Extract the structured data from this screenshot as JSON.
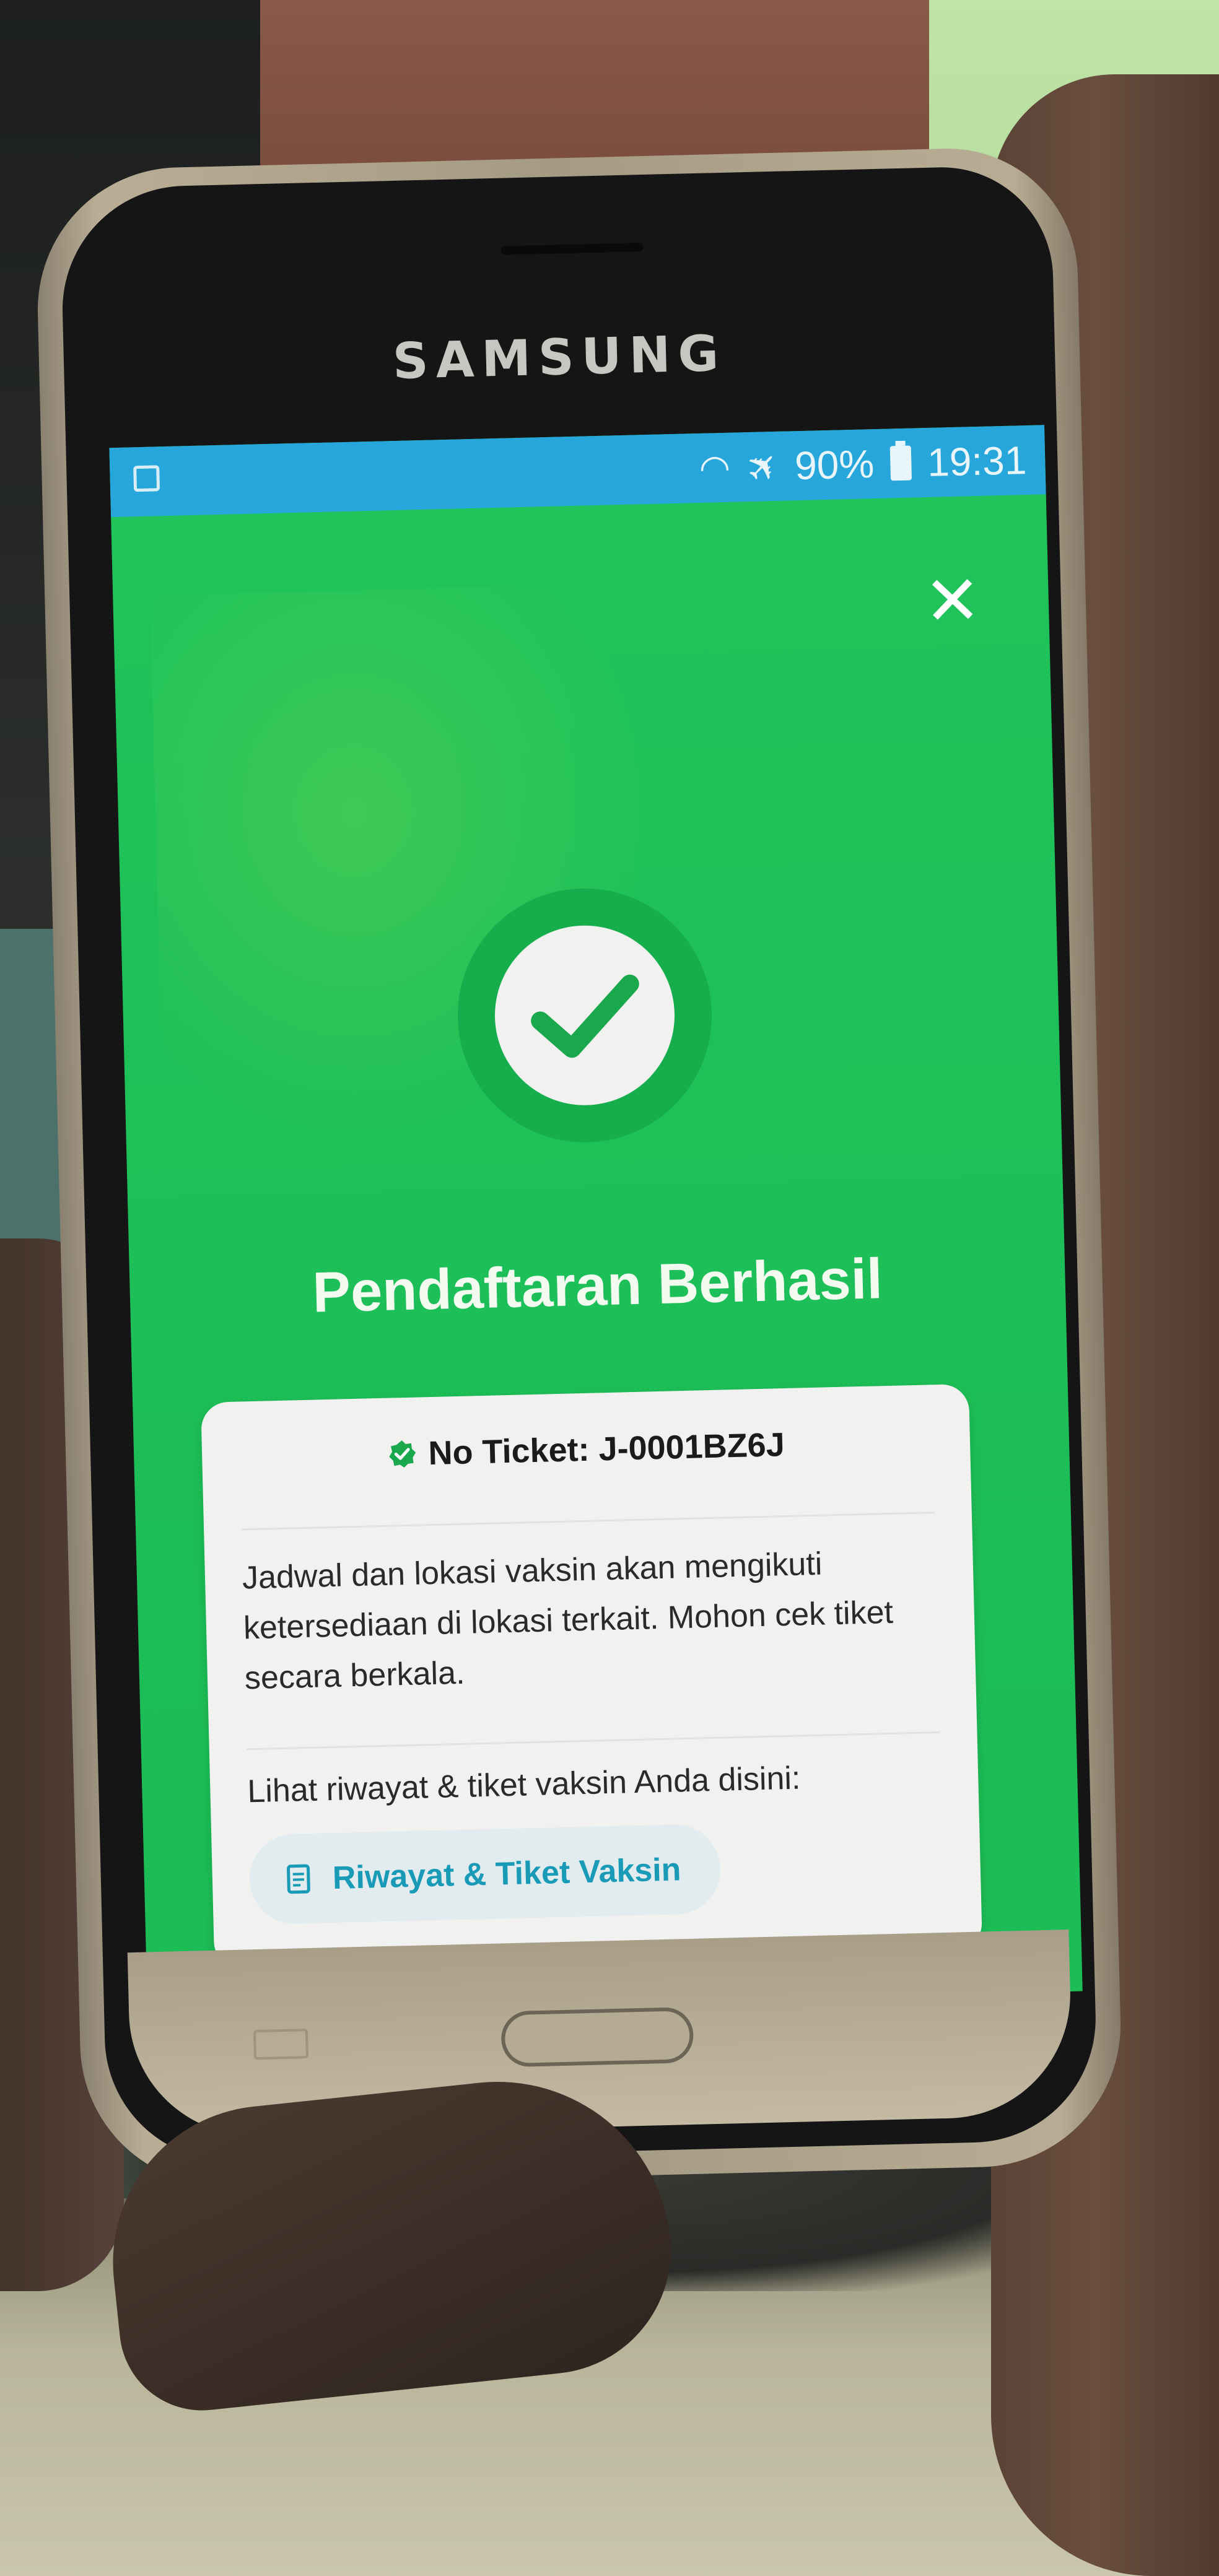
{
  "device": {
    "brand": "SAMSUNG"
  },
  "status_bar": {
    "battery": "90%",
    "time": "19:31"
  },
  "colors": {
    "screen_bg": "#1dbf58",
    "status_bar": "#27a6dc",
    "card_bg": "#f1f1f0",
    "link": "#199ab7",
    "check": "#1aa84c"
  },
  "success": {
    "title": "Pendaftaran Berhasil",
    "icon": "check-icon"
  },
  "ticket": {
    "label": "No Ticket: J-0001BZ6J",
    "info": "Jadwal dan lokasi vaksin akan mengikuti ketersediaan di lokasi terkait. Mohon cek tiket secara berkala.",
    "history_label": "Lihat riwayat & tiket vaksin Anda disini:",
    "history_button": "Riwayat & Tiket Vaksin"
  }
}
